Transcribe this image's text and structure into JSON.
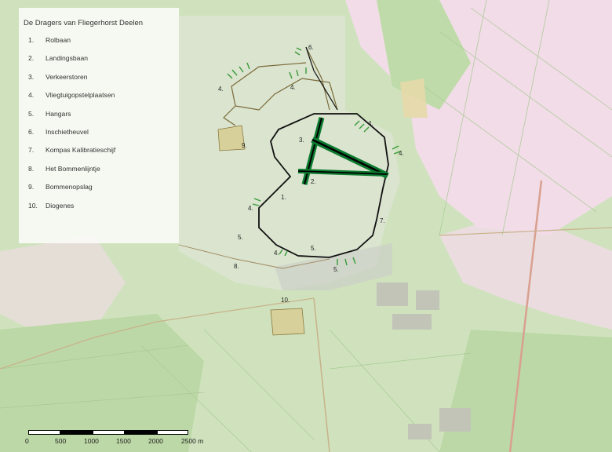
{
  "map": {
    "land_color": "#cfe2bd",
    "forest_color": "#b9d7a2",
    "heath_color": "#f1dce7",
    "airbase_color": "#e4e6df",
    "boundary_color": "#111111",
    "runway_color": "#0c7a2f"
  },
  "legend": {
    "title": "De Dragers van Fliegerhorst Deelen",
    "items": [
      {
        "num": "1.",
        "label": "Rolbaan"
      },
      {
        "num": "2.",
        "label": "Landingsbaan"
      },
      {
        "num": "3.",
        "label": "Verkeerstoren"
      },
      {
        "num": "4.",
        "label": "Vliegtuigopstelplaatsen"
      },
      {
        "num": "5.",
        "label": "Hangars"
      },
      {
        "num": "6.",
        "label": "Inschietheuvel"
      },
      {
        "num": "7.",
        "label": "Kompas Kalibratieschijf"
      },
      {
        "num": "8.",
        "label": "Het Bommenlijntje"
      },
      {
        "num": "9.",
        "label": "Bommenopslag"
      },
      {
        "num": "10.",
        "label": "Diogenes"
      }
    ]
  },
  "markers": [
    "1.",
    "2.",
    "3.",
    "4.",
    "4.",
    "4.",
    "4.",
    "4.",
    "4.",
    "5.",
    "5.",
    "5.",
    "6.",
    "7.",
    "8.",
    "9.",
    "10."
  ],
  "scalebar": {
    "labels": [
      "0",
      "500",
      "1000",
      "1500",
      "2000",
      "2500 m"
    ]
  }
}
